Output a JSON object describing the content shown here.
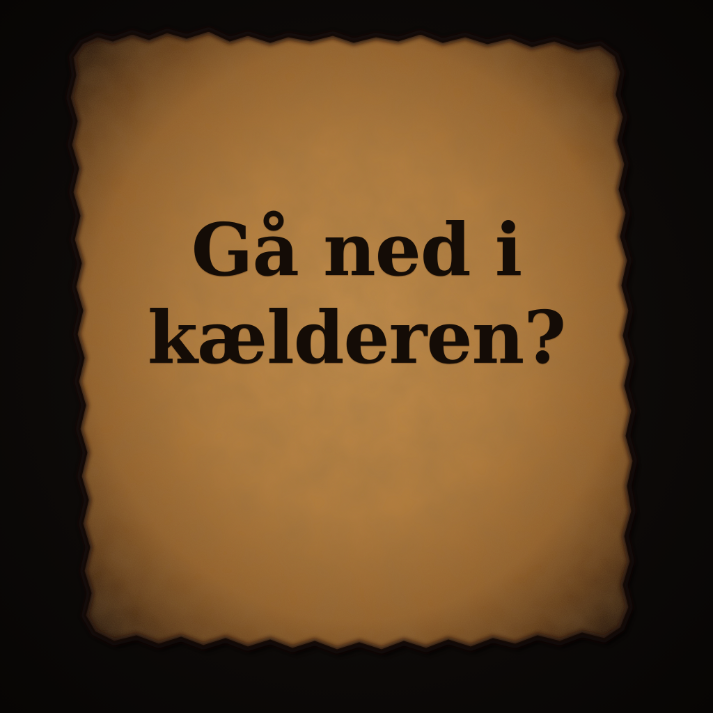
{
  "note": {
    "line1": "Gå ned i",
    "line2": "kælderen?"
  },
  "colors": {
    "background": "#0d0a08",
    "parchment_light": "#c08a48",
    "parchment_mid": "#9c6a32",
    "parchment_burn": "#3a220e",
    "ink": "#140c06"
  }
}
